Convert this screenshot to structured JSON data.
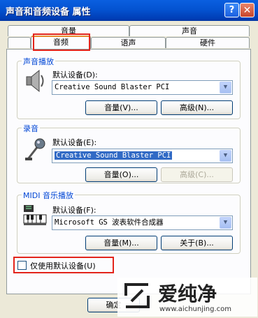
{
  "window": {
    "title": "声音和音频设备 属性",
    "help_glyph": "?",
    "close_glyph": "✕"
  },
  "tabs_top": [
    "音量",
    "声音"
  ],
  "tabs_bottom": [
    "音频",
    "语声",
    "硬件"
  ],
  "playback": {
    "group_label": "声音播放",
    "default_label": "默认设备(D):",
    "device": "Creative Sound Blaster PCI",
    "volume_button": "音量(V)...",
    "advanced_button": "高级(N)..."
  },
  "recording": {
    "group_label": "录音",
    "default_label": "默认设备(E):",
    "device": "Creative Sound Blaster PCI",
    "volume_button": "音量(O)...",
    "advanced_button": "高级(C)..."
  },
  "midi": {
    "group_label": "MIDI 音乐播放",
    "default_label": "默认设备(F):",
    "device": "Microsoft GS 波表软件合成器",
    "volume_button": "音量(M)...",
    "about_button": "关于(B)..."
  },
  "use_default_only": {
    "label": "仅使用默认设备(U)",
    "checked": false
  },
  "ok_button": "确定",
  "watermark": {
    "brand": "爱纯净",
    "url": "www.aichunjing.com"
  },
  "colors": {
    "title_bar": "#0453D1",
    "highlight": "#E3241B",
    "group_label": "#0046D5"
  }
}
